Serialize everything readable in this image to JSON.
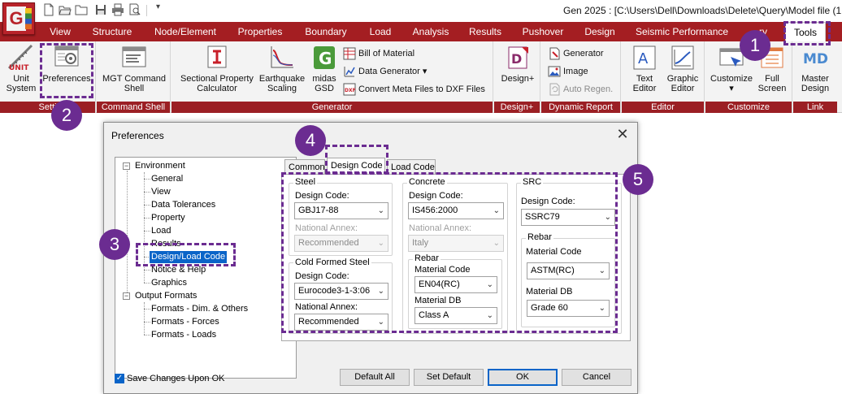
{
  "window": {
    "title": "Gen 2025 : [C:\\Users\\Dell\\Downloads\\Delete\\Query\\Model file (1",
    "logo_letter": "G"
  },
  "quick_access": [
    "new-icon",
    "open-icon",
    "folder-icon",
    "save-icon",
    "print-icon",
    "print-preview-icon"
  ],
  "quick_access_more": "▾",
  "tabs": [
    "View",
    "Structure",
    "Node/Element",
    "Properties",
    "Boundary",
    "Load",
    "Analysis",
    "Results",
    "Pushover",
    "Design",
    "Seismic Performance",
    "ry",
    "Tools"
  ],
  "active_tab": "Tools",
  "ribbon": {
    "settings": {
      "label": "Setti",
      "unit_icon_text": "UNIT",
      "unit_system": [
        "Unit",
        "System"
      ],
      "preferences": "Preferences"
    },
    "command_shell": {
      "label": "Command Shell",
      "mgt": [
        "MGT Command",
        "Shell"
      ]
    },
    "generator": {
      "label": "Generator",
      "sectional": [
        "Sectional Property",
        "Calculator"
      ],
      "earthquake": [
        "Earthquake",
        "Scaling"
      ],
      "midas_gsd": [
        "midas",
        "GSD"
      ],
      "bill_of_material": "Bill of Material",
      "data_generator": "Data Generator",
      "data_generator_arrow": "▾",
      "convert_meta": "Convert Meta Files to DXF Files"
    },
    "design_plus": {
      "label": "Design+",
      "button": "Design+"
    },
    "dynamic_report": {
      "label": "Dynamic Report",
      "generator": "Generator",
      "image": "Image",
      "auto_regen": "Auto Regen."
    },
    "editor": {
      "label": "Editor",
      "text_editor": [
        "Text",
        "Editor"
      ],
      "graphic_editor": [
        "Graphic",
        "Editor"
      ]
    },
    "customize": {
      "label": "Customize",
      "customize": "Customize",
      "customize_arrow": "▾",
      "full_screen": [
        "Full",
        "Screen"
      ]
    },
    "link": {
      "label": "Link",
      "master_design": [
        "Master",
        "Design"
      ]
    }
  },
  "steps": [
    "1",
    "2",
    "3",
    "4",
    "5"
  ],
  "dialog": {
    "title": "Preferences",
    "close": "✕",
    "tree": {
      "environment": "Environment",
      "environment_children": [
        "General",
        "View",
        "Data Tolerances",
        "Property",
        "Load",
        "Results",
        "Design/Load Code",
        "Notice & Help",
        "Graphics"
      ],
      "output_formats": "Output Formats",
      "output_children": [
        "Formats - Dim. & Others",
        "Formats - Forces",
        "Formats - Loads"
      ],
      "selected": "Design/Load Code",
      "expander": "−"
    },
    "tabs": [
      "Common",
      "Design Code",
      "Load Code"
    ],
    "active_tab": "Design Code",
    "steel": {
      "legend": "Steel",
      "design_code_label": "Design Code:",
      "design_code": "GBJ17-88",
      "annex_label": "National Annex:",
      "annex": "Recommended"
    },
    "cold_formed": {
      "legend": "Cold Formed Steel",
      "design_code_label": "Design Code:",
      "design_code": "Eurocode3-1-3:06",
      "annex_label": "National Annex:",
      "annex": "Recommended"
    },
    "concrete": {
      "legend": "Concrete",
      "design_code_label": "Design Code:",
      "design_code": "IS456:2000",
      "annex_label": "National Annex:",
      "annex": "Italy",
      "rebar_legend": "Rebar",
      "material_code_label": "Material Code",
      "material_code": "EN04(RC)",
      "material_db_label": "Material DB",
      "material_db": "Class A"
    },
    "src": {
      "legend": "SRC",
      "design_code_label": "Design Code:",
      "design_code": "SSRC79",
      "rebar_legend": "Rebar",
      "material_code_label": "Material Code",
      "material_code": "ASTM(RC)",
      "material_db_label": "Material DB",
      "material_db": "Grade 60"
    },
    "combo_arrow": "⌄",
    "save_changes": "Save Changes Upon OK",
    "checkmark": "✓",
    "buttons": {
      "default_all": "Default All",
      "set_default": "Set Default",
      "ok": "OK",
      "cancel": "Cancel"
    }
  },
  "colors": {
    "brand_red": "#a41e22",
    "step_purple": "#6b2c91",
    "selection_blue": "#0a64c8"
  }
}
